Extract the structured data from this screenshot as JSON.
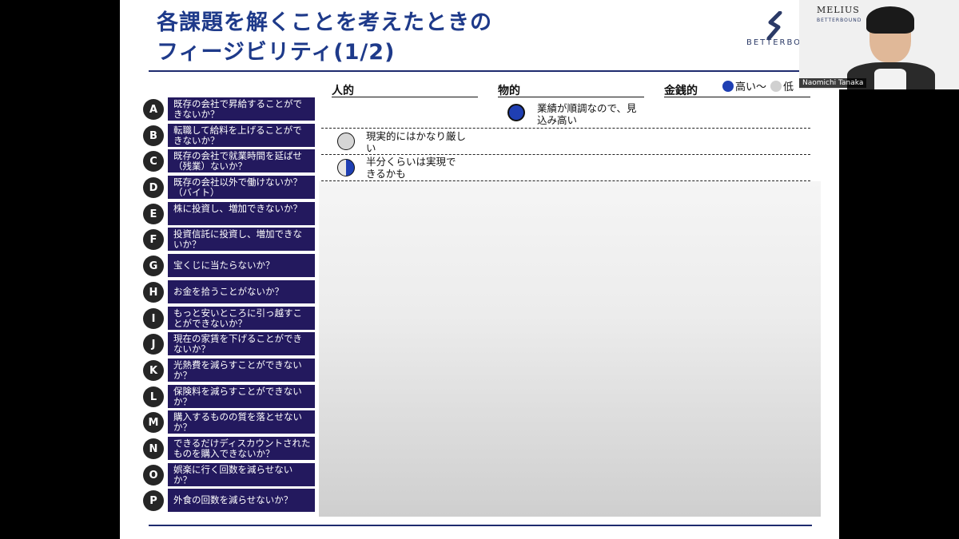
{
  "slide": {
    "title_line1": "各課題を解くことを考えたときの",
    "title_line2": "フィージビリティ(1/2)",
    "logo_text": "BETTERBO"
  },
  "columns": {
    "human": "人的",
    "material": "物的",
    "financial": "金銭的"
  },
  "legend": {
    "high": "高い～",
    "low": "低"
  },
  "items": [
    {
      "letter": "A",
      "text": "既存の会社で昇給することができないか？"
    },
    {
      "letter": "B",
      "text": "転職して給料を上げることができないか？"
    },
    {
      "letter": "C",
      "text": "既存の会社で就業時間を延ばせ（残業）ないか？"
    },
    {
      "letter": "D",
      "text": "既存の会社以外で働けないか？（バイト）"
    },
    {
      "letter": "E",
      "text": "株に投資し、増加できないか？"
    },
    {
      "letter": "F",
      "text": "投資信託に投資し、増加できないか？"
    },
    {
      "letter": "G",
      "text": "宝くじに当たらないか？"
    },
    {
      "letter": "H",
      "text": "お金を拾うことがないか？"
    },
    {
      "letter": "I",
      "text": "もっと安いところに引っ越すことができないか？"
    },
    {
      "letter": "J",
      "text": "現在の家賃を下げることができないか？"
    },
    {
      "letter": "K",
      "text": "光熱費を減らすことができないか？"
    },
    {
      "letter": "L",
      "text": "保険料を減らすことができないか？"
    },
    {
      "letter": "M",
      "text": "購入するものの質を落とせないか？"
    },
    {
      "letter": "N",
      "text": "できるだけディスカウントされたものを購入できないか？"
    },
    {
      "letter": "O",
      "text": "娯楽に行く回数を減らせないか？"
    },
    {
      "letter": "P",
      "text": "外食の回数を減らせないか？"
    }
  ],
  "cells": {
    "a_material": "業績が順調なので、見込み高い",
    "b_human": "現実的にはかなり厳しい",
    "c_human": "半分くらいは実現できるかも"
  },
  "video": {
    "brand": "MELIUS",
    "brand_sub": "BETTERBOUND",
    "name": "Naomichi Tanaka"
  },
  "colors": {
    "title": "#1e3a8a",
    "label_bg": "#23195e",
    "high": "#1f3fb3",
    "low": "#d0d0d0"
  }
}
